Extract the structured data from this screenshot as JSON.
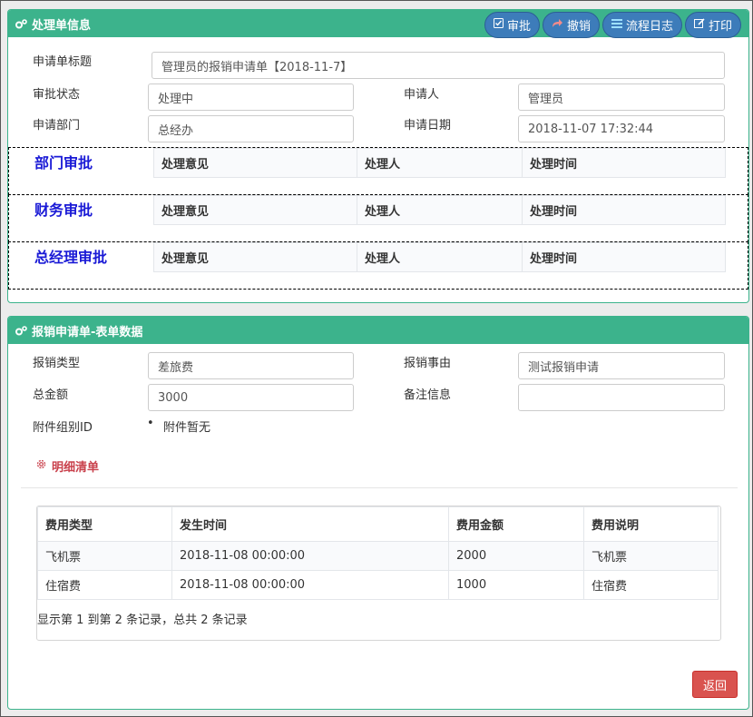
{
  "panel1": {
    "title": "处理单信息",
    "toolbar": {
      "approve": "审批",
      "revoke": "撤销",
      "log": "流程日志",
      "print": "打印"
    },
    "fields": {
      "title_label": "申请单标题",
      "title_value": "管理员的报销申请单【2018-11-7】",
      "status_label": "审批状态",
      "status_value": "处理中",
      "applicant_label": "申请人",
      "applicant_value": "管理员",
      "dept_label": "申请部门",
      "dept_value": "总经办",
      "date_label": "申请日期",
      "date_value": "2018-11-07 17:32:44"
    },
    "approvals": [
      {
        "title": "部门审批",
        "cols": [
          "处理意见",
          "处理人",
          "处理时间"
        ]
      },
      {
        "title": "财务审批",
        "cols": [
          "处理意见",
          "处理人",
          "处理时间"
        ]
      },
      {
        "title": "总经理审批",
        "cols": [
          "处理意见",
          "处理人",
          "处理时间"
        ]
      }
    ]
  },
  "panel2": {
    "title": "报销申请单-表单数据",
    "fields": {
      "type_label": "报销类型",
      "type_value": "差旅费",
      "reason_label": "报销事由",
      "reason_value": "测试报销申请",
      "amount_label": "总金额",
      "amount_value": "3000",
      "note_label": "备注信息",
      "note_value": "",
      "attach_label": "附件组别ID",
      "attach_value": "附件暂无"
    },
    "detail_title": "明细清单",
    "table": {
      "headers": [
        "费用类型",
        "发生时间",
        "费用金额",
        "费用说明"
      ],
      "rows": [
        [
          "飞机票",
          "2018-11-08 00:00:00",
          "2000",
          "飞机票"
        ],
        [
          "住宿费",
          "2018-11-08 00:00:00",
          "1000",
          "住宿费"
        ]
      ]
    },
    "pager": "显示第 1 到第 2 条记录，总共 2 条记录",
    "back_label": "返回"
  },
  "colors": {
    "header_green": "#3cb38c",
    "button_blue": "#3d7cba",
    "approval_title": "#1a1ad6",
    "detail_red": "#c9414c",
    "back_red": "#d9534f"
  }
}
